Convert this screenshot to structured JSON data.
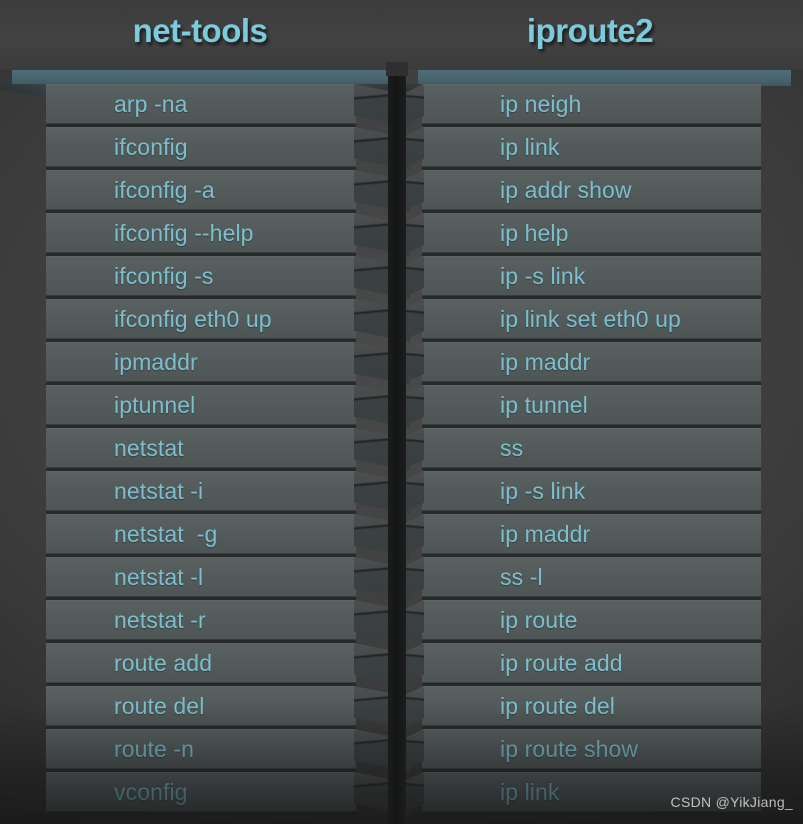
{
  "columns": [
    {
      "title": "net-tools",
      "rows": [
        "arp -na",
        "ifconfig",
        "ifconfig -a",
        "ifconfig --help",
        "ifconfig -s",
        "ifconfig eth0 up",
        "ipmaddr",
        "iptunnel",
        "netstat",
        "netstat -i",
        "netstat  -g",
        "netstat -l",
        "netstat -r",
        "route add",
        "route del",
        "route -n",
        "vconfig"
      ]
    },
    {
      "title": "iproute2",
      "rows": [
        "ip neigh",
        "ip link",
        "ip addr show",
        "ip help",
        "ip -s link",
        "ip link set eth0 up",
        "ip maddr",
        "ip tunnel",
        "ss",
        "ip -s link",
        "ip maddr",
        "ss -l",
        "ip route",
        "ip route add",
        "ip route del",
        "ip route show",
        "ip link"
      ]
    }
  ],
  "watermark": "CSDN @YikJiang_",
  "colors": {
    "title_text": "#7ccbdd",
    "row_text": "#7fc8d8",
    "row_face": "#545b5b",
    "cap_strip": "#47636d",
    "background": "#3a3a3a"
  }
}
